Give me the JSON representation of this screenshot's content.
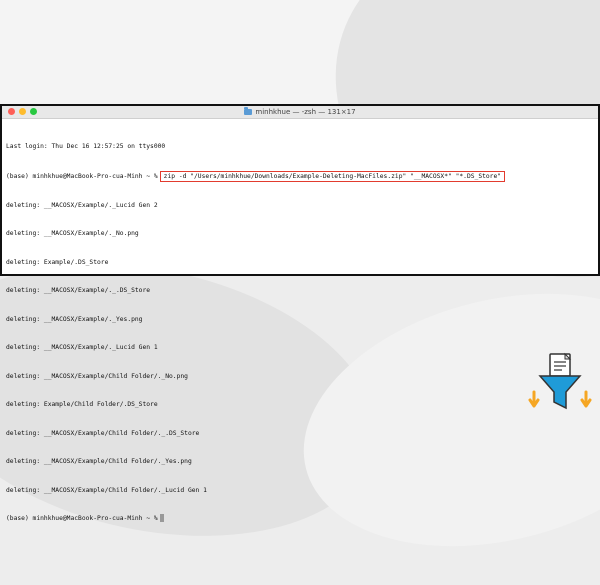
{
  "window": {
    "title": "minhkhue — -zsh — 131×17"
  },
  "terminal": {
    "last_login": "Last login: Thu Dec 16 12:57:25 on ttys000",
    "prompt": "(base) minhkhue@MacBook-Pro-cua-Minh ~ %",
    "command": "zip -d \"/Users/minhkhue/Downloads/Example-Deleting-MacFiles.zip\" \"__MACOSX*\" \"*.DS_Store\"",
    "output": [
      "deleting: __MACOSX/Example/._Lucid Gen 2",
      "deleting: __MACOSX/Example/._No.png",
      "deleting: Example/.DS_Store",
      "deleting: __MACOSX/Example/._.DS_Store",
      "deleting: __MACOSX/Example/._Yes.png",
      "deleting: __MACOSX/Example/._Lucid Gen 1",
      "deleting: __MACOSX/Example/Child Folder/._No.png",
      "deleting: Example/Child Folder/.DS_Store",
      "deleting: __MACOSX/Example/Child Folder/._.DS_Store",
      "deleting: __MACOSX/Example/Child Folder/._Yes.png",
      "deleting: __MACOSX/Example/Child Folder/._Lucid Gen 1"
    ],
    "final_prompt": "(base) minhkhue@MacBook-Pro-cua-Minh ~ %"
  },
  "colors": {
    "highlight_border": "#e23b2e",
    "logo_blue": "#1f9bd8",
    "logo_orange": "#f5a623"
  },
  "icons": {
    "window_controls": [
      "close-button",
      "minimize-button",
      "zoom-button"
    ],
    "title_icon": "folder-icon",
    "logo": "document-filter-icon"
  }
}
